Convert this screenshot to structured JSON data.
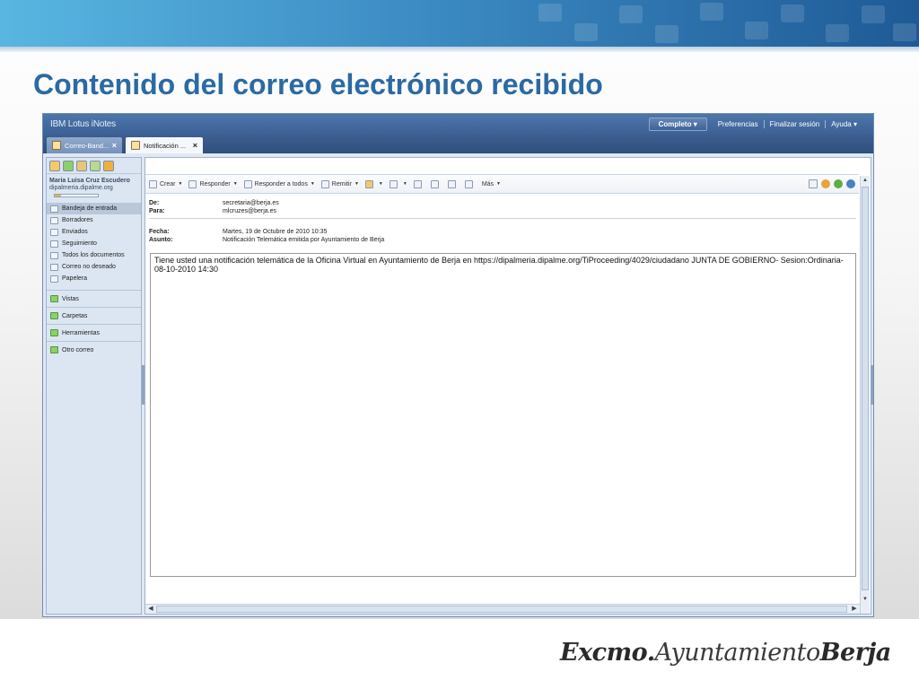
{
  "slide": {
    "title": "Contenido del correo electrónico recibido",
    "footer": {
      "part1": "Excmo.",
      "part2": "Ayuntamiento",
      "part3": "Berja"
    }
  },
  "app": {
    "brand": "IBM Lotus iNotes",
    "header_links": {
      "mode": "Completo ▾",
      "preferences": "Preferencias",
      "logout": "Finalizar sesión",
      "help": "Ayuda ▾"
    },
    "tabs": [
      {
        "label": "Correo-Band...",
        "close": "×"
      },
      {
        "label": "Notificación ...",
        "close": "×"
      }
    ],
    "user": {
      "name": "Maria Luisa Cruz Escudero",
      "email": "dipalmeria.dipalme.org",
      "quota_fraction": 0.15
    },
    "folders": [
      "Bandeja de entrada",
      "Borradores",
      "Enviados",
      "Seguimiento",
      "Todos los documentos",
      "Correo no deseado",
      "Papelera"
    ],
    "sections": [
      "Vistas",
      "Carpetas",
      "Herramientas",
      "Otro correo"
    ],
    "toolbar": {
      "crear": "Crear",
      "responder": "Responder",
      "responder_todos": "Responder a todos",
      "remitir": "Remitir",
      "mas": "Más"
    },
    "message": {
      "labels": {
        "from": "De:",
        "to": "Para:",
        "date": "Fecha:",
        "subject": "Asunto:"
      },
      "from": "secretaria@berja.es",
      "to": "mlcruzes@berja.es",
      "date": "Martes, 19 de Octubre de 2010 10:35",
      "subject": "Notificación Telemática emitida por Ayuntamiento de Berja",
      "body": "Tiene usted una notificación telemática de la Oficina Virtual en Ayuntamiento de Berja en https://dipalmeria.dipalme.org/TiProceeding/4029/ciudadano JUNTA DE GOBIERNO- Sesion:Ordinaria-08-10-2010 14:30"
    }
  },
  "colors": {
    "title": "#2b6aa3",
    "header": "#3b6096",
    "sidebar": "#dce6f2"
  }
}
